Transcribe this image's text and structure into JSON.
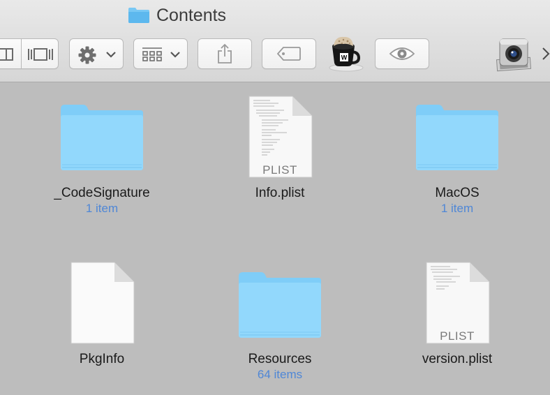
{
  "window": {
    "title": "Contents",
    "title_icon": "folder-icon"
  },
  "toolbar": {
    "view_buttons": [
      "columns-view-icon",
      "cover-flow-view-icon"
    ],
    "action_button": "gear-icon",
    "arrange_button": "grid-arrange-icon",
    "share_button": "share-icon",
    "tags_button": "tag-icon",
    "app_button": "cafe-app-icon",
    "app_badge": "W",
    "quicklook_button": "eye-icon",
    "capture_app": "image-capture-icon",
    "overflow": "chevron-right-icon"
  },
  "items": [
    {
      "name": "_CodeSignature",
      "count": "1 item",
      "kind": "folder"
    },
    {
      "name": "Info.plist",
      "count": "",
      "kind": "plist",
      "badge": "PLIST"
    },
    {
      "name": "MacOS",
      "count": "1 item",
      "kind": "folder"
    },
    {
      "name": "PkgInfo",
      "count": "",
      "kind": "blank"
    },
    {
      "name": "Resources",
      "count": "64 items",
      "kind": "folder"
    },
    {
      "name": "version.plist",
      "count": "",
      "kind": "plist",
      "badge": "PLIST"
    }
  ],
  "colors": {
    "folder_light": "#8fd6fb",
    "folder_dark": "#6ac3f5",
    "count_text": "#4f87d6",
    "background": "#bdbdbd"
  }
}
